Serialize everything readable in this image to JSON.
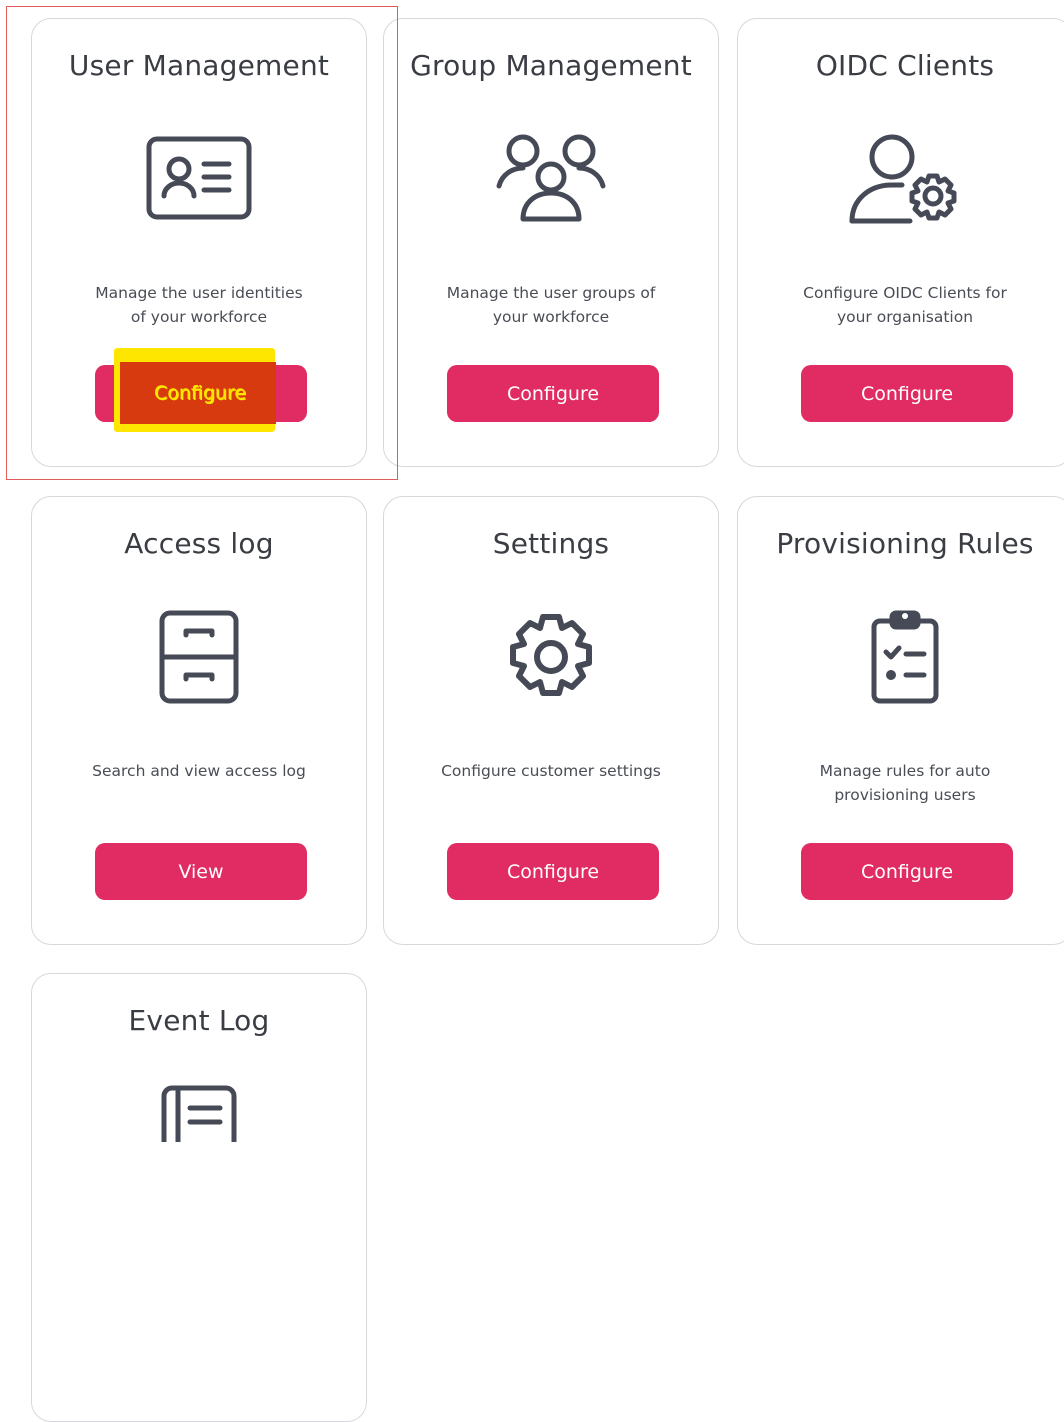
{
  "cards": [
    {
      "title": "User Management",
      "icon": "id-card-icon",
      "desc_line1": "Manage the user identities",
      "desc_line2": "of your workforce",
      "button": "Configure"
    },
    {
      "title": "Group Management",
      "icon": "users-group-icon",
      "desc_line1": "Manage the user groups of",
      "desc_line2": "your workforce",
      "button": "Configure"
    },
    {
      "title": "OIDC Clients",
      "icon": "user-gear-icon",
      "desc_line1": "Configure OIDC Clients for",
      "desc_line2": "your organisation",
      "button": "Configure"
    },
    {
      "title": "Access log",
      "icon": "file-cabinet-icon",
      "desc_line1": "Search and view access log",
      "desc_line2": "",
      "button": "View"
    },
    {
      "title": "Settings",
      "icon": "gear-icon",
      "desc_line1": "Configure customer settings",
      "desc_line2": "",
      "button": "Configure"
    },
    {
      "title": "Provisioning Rules",
      "icon": "clipboard-checklist-icon",
      "desc_line1": "Manage rules for auto",
      "desc_line2": "provisioning users",
      "button": "Configure"
    },
    {
      "title": "Event Log",
      "icon": "event-list-icon"
    }
  ],
  "colors": {
    "accent": "#e02b63",
    "icon_stroke": "#454a56",
    "highlight_yellow": "#ffe600",
    "highlight_red": "#d83a10",
    "annotation_frame": "#e35a5a"
  }
}
